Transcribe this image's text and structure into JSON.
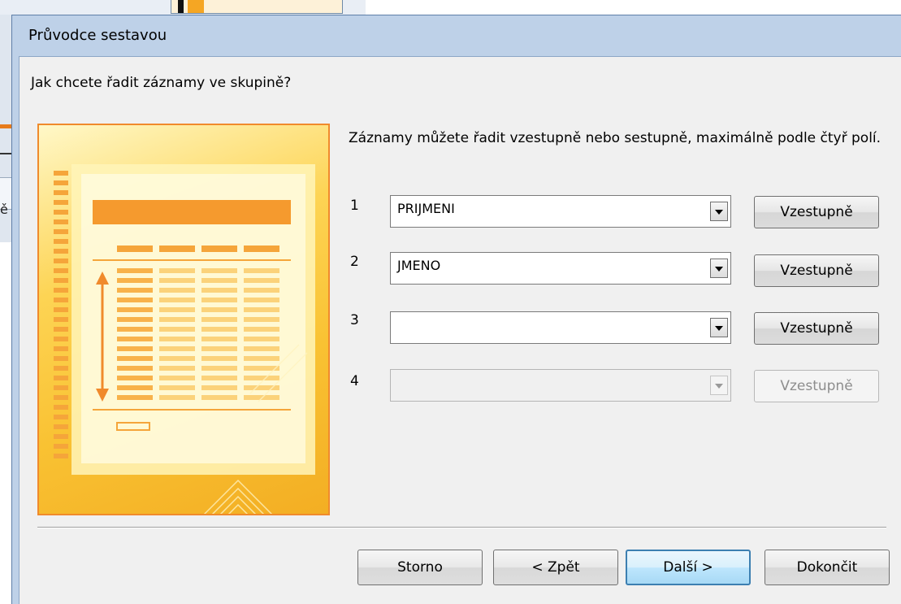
{
  "dialog": {
    "title": "Průvodce sestavou",
    "question": "Jak chcete řadit záznamy ve skupině?",
    "description": "Záznamy můžete řadit vzestupně nebo sestupně, maximálně podle čtyř polí."
  },
  "background": {
    "fragment_text": "ě"
  },
  "sort_rows": [
    {
      "number": "1",
      "field": "PRIJMENI",
      "order_label": "Vzestupně",
      "enabled": true
    },
    {
      "number": "2",
      "field": "JMENO",
      "order_label": "Vzestupně",
      "enabled": true
    },
    {
      "number": "3",
      "field": "",
      "order_label": "Vzestupně",
      "enabled": true
    },
    {
      "number": "4",
      "field": "",
      "order_label": "Vzestupně",
      "enabled": false
    }
  ],
  "buttons": {
    "cancel": "Storno",
    "back": "< Zpět",
    "next": "Další >",
    "finish": "Dokončit"
  },
  "colors": {
    "title_bar": "#bed1e8",
    "illustration_border": "#f08a2c",
    "illustration_fill": "#fdd454",
    "default_button_border": "#3c7fb1"
  },
  "icons": {
    "dropdown": "chevron-down-icon",
    "illustration": "report-wizard-illustration"
  }
}
